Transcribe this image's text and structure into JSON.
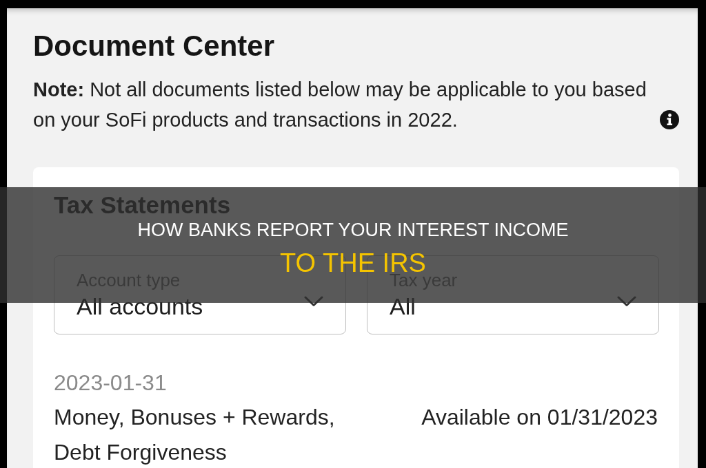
{
  "page": {
    "title": "Document Center",
    "note": "**Note:** Not all documents listed below may be applicable to you based on your SoFi products and transactions in 2022."
  },
  "tax_statements": {
    "title": "Tax Statements",
    "filters": [
      {
        "label": "Account type",
        "value": "All accounts"
      },
      {
        "label": "Tax year",
        "value": "All"
      }
    ],
    "documents": [
      {
        "date": "2023-01-31",
        "name": "Money, Bonuses + Rewards, Debt Forgiveness",
        "status": "Available on 01/31/2023"
      }
    ]
  },
  "overlay_banner": {
    "lines": [
      {
        "kind": "plain",
        "text": "HOW BANKS REPORT YOUR INTEREST INCOME"
      },
      {
        "kind": "highlight",
        "text": "TO THE IRS"
      }
    ]
  }
}
